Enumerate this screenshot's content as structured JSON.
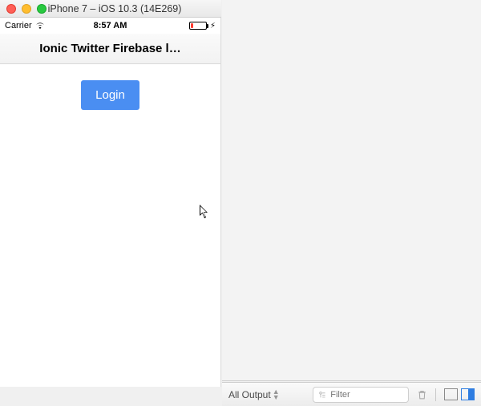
{
  "window": {
    "title": "iPhone 7 – iOS 10.3 (14E269)"
  },
  "status_bar": {
    "carrier": "Carrier",
    "time": "8:57 AM"
  },
  "app": {
    "title": "Ionic Twitter Firebase l…",
    "login_button": "Login"
  },
  "console": {
    "scope_label": "All Output",
    "filter_placeholder": "Filter"
  },
  "icons": {
    "wifi": "wifi-icon",
    "battery": "battery-icon",
    "bolt": "bolt-icon",
    "filter": "filter-icon",
    "trash": "trash-icon",
    "pane_left": "left-pane-toggle-icon",
    "pane_right": "right-pane-toggle-icon"
  }
}
